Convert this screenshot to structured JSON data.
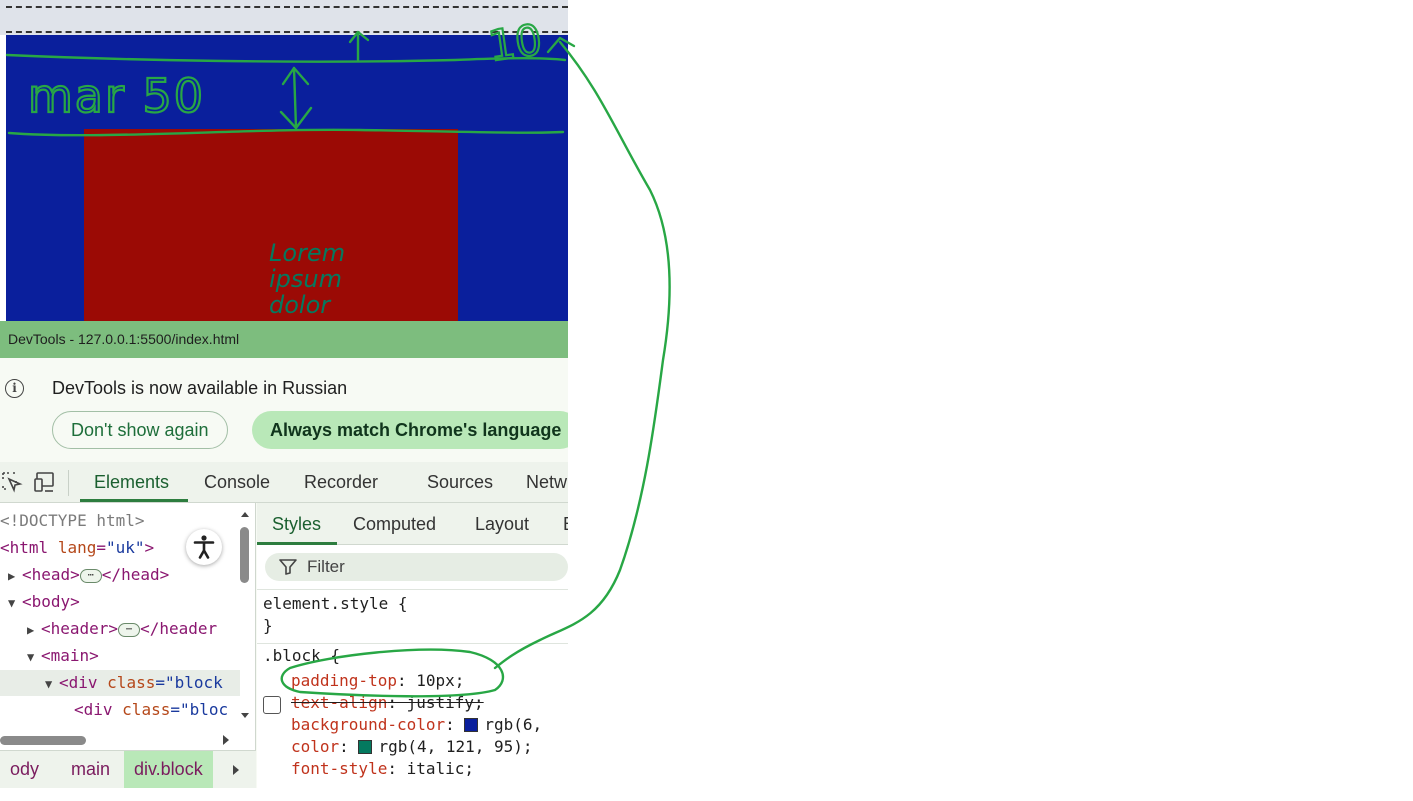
{
  "preview": {
    "lorem_lines": [
      "Lorem",
      "ipsum",
      "dolor"
    ]
  },
  "devtools": {
    "title": "DevTools - 127.0.0.1:5500/index.html",
    "banner": {
      "message": "DevTools is now available in Russian",
      "dont_show_label": "Don't show again",
      "always_match_label": "Always match Chrome's language"
    },
    "tabs": [
      "Elements",
      "Console",
      "Recorder",
      "Sources",
      "Netw"
    ],
    "dom": {
      "doctype": "<!DOCTYPE html>",
      "html_open": "<html",
      "html_lang_attr": "lang",
      "html_lang_val": "\"uk\"",
      "html_close": ">",
      "head_open": "<head>",
      "head_close": "</head>",
      "body_open": "<body>",
      "header_open": "<header>",
      "header_close": "</header",
      "main_open": "<main>",
      "div_block_tag": "<div",
      "div_block_attr": "class",
      "div_block_val": "=\"block",
      "div_bloc_tag": "<div",
      "div_bloc_attr": "class",
      "div_bloc_val": "=\"bloc",
      "ellipsis": "⋯"
    },
    "styles_tabs": [
      "Styles",
      "Computed",
      "Layout",
      "E"
    ],
    "filter_placeholder": "Filter",
    "css": {
      "element_style_open": "element.style {",
      "element_style_close": "}",
      "block_selector": ".block {",
      "padding_prop": "padding-top",
      "padding_val": ": 10px;",
      "text_align_prop": "text-align",
      "text_align_val": ": justify;",
      "bg_prop": "background-color",
      "bg_val": "rgb(6,",
      "color_prop": "color",
      "color_val": "rgb(4, 121, 95);",
      "font_style_prop": "font-style",
      "font_style_val": ": italic;"
    },
    "breadcrumb": [
      "ody",
      "main",
      "div.block"
    ]
  },
  "annotation": {
    "margin_note": "mar 50",
    "ten_note": "10"
  },
  "colors": {
    "preview_bg": "#0a1f9c",
    "block_bg": "#9b0a05",
    "text_green": "#04795f",
    "pen_green": "#28a745",
    "swatch_bg": "#0a1f9c",
    "swatch_color": "#04795f"
  }
}
